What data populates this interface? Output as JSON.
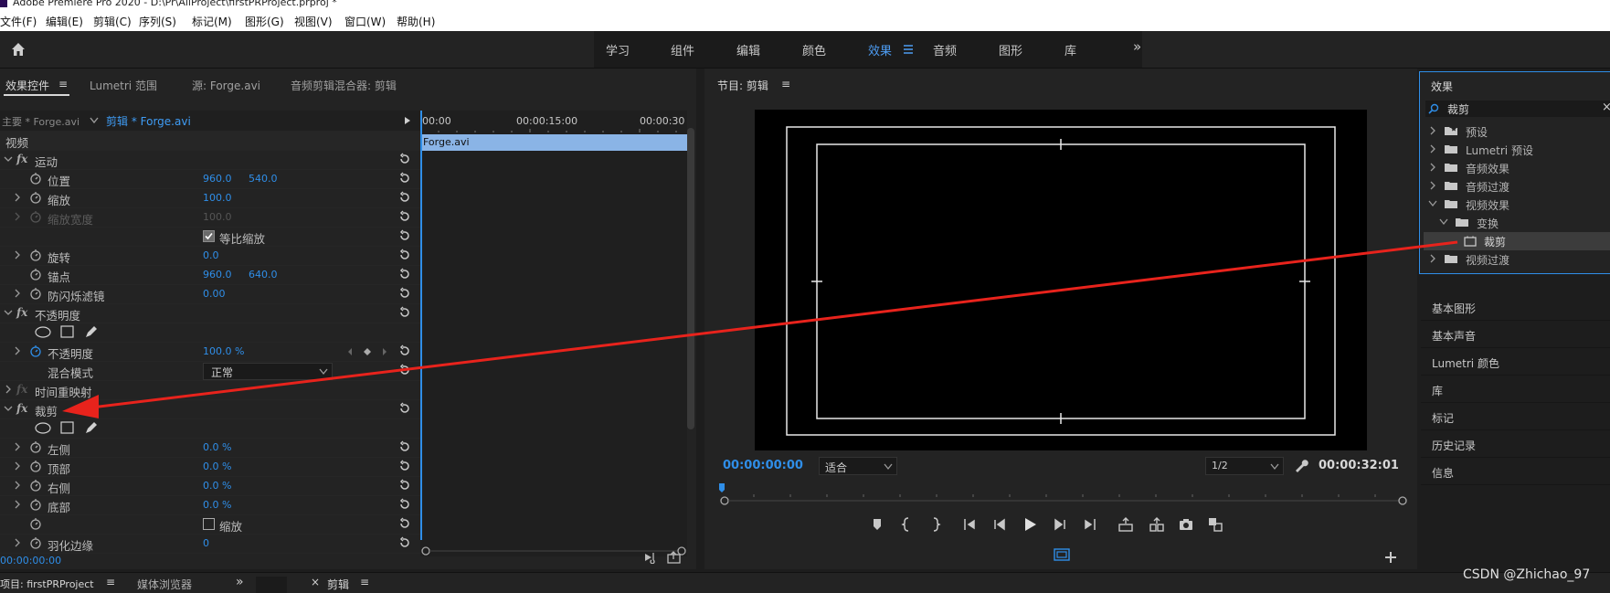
{
  "window": {
    "title": "Adobe Premiere Pro 2020 - D:\\Pr\\AllProject\\firstPRProject.prproj *"
  },
  "menu": [
    "文件(F)",
    "编辑(E)",
    "剪辑(C)",
    "序列(S)",
    "标记(M)",
    "图形(G)",
    "视图(V)",
    "窗口(W)",
    "帮助(H)"
  ],
  "workspaces": {
    "tabs": [
      "学习",
      "组件",
      "编辑",
      "颜色",
      "效果",
      "音频",
      "图形",
      "库"
    ],
    "active": "效果",
    "more": "»"
  },
  "effect_controls": {
    "tabs": [
      "效果控件",
      "Lumetri 范围",
      "源: Forge.avi",
      "音频剪辑混合器: 剪辑"
    ],
    "menu_glyph": "≡",
    "master_label": "主要 * Forge.avi",
    "clip_label": "剪辑 * Forge.avi",
    "section_video": "视频",
    "rows": {
      "motion": "运动",
      "position": "位置",
      "position_x": "960.0",
      "position_y": "540.0",
      "scale": "缩放",
      "scale_value": "100.0",
      "scale_width": "缩放宽度",
      "scale_width_value": "100.0",
      "uniform_scale": "等比缩放",
      "rotation": "旋转",
      "rotation_value": "0.0",
      "anchor": "锚点",
      "anchor_x": "960.0",
      "anchor_y": "640.0",
      "anti_flicker": "防闪烁滤镜",
      "anti_flicker_value": "0.00",
      "opacity_group": "不透明度",
      "opacity": "不透明度",
      "opacity_value": "100.0 %",
      "blend_mode": "混合模式",
      "blend_value": "正常",
      "time_remap": "时间重映射",
      "crop": "裁剪",
      "left": "左侧",
      "left_value": "0.0 %",
      "top": "顶部",
      "top_value": "0.0 %",
      "right": "右侧",
      "right_value": "0.0 %",
      "bottom": "底部",
      "bottom_value": "0.0 %",
      "zoom": "缩放",
      "feather": "羽化边缘",
      "feather_value": "0"
    },
    "timeline": {
      "t0": "00:00",
      "t1": "00:00:15:00",
      "t2": "00:00:30",
      "clip": "Forge.avi"
    },
    "timecode": "00:00:00:00"
  },
  "program": {
    "title": "节目: 剪辑",
    "menu_glyph": "≡",
    "timecode": "00:00:00:00",
    "fit": "适合",
    "resolution": "1/2",
    "duration": "00:00:32:01"
  },
  "effects_panel": {
    "title": "效果",
    "search_value": "裁剪",
    "tree": [
      "预设",
      "Lumetri 预设",
      "音频效果",
      "音频过渡",
      "视频效果",
      "变换",
      "裁剪",
      "视频过渡"
    ]
  },
  "right_panels": [
    "基本图形",
    "基本声音",
    "Lumetri 颜色",
    "库",
    "标记",
    "历史记录",
    "信息"
  ],
  "bottom": {
    "project_tab": "项目: firstPRProject",
    "media_browser": "媒体浏览器",
    "more": "»",
    "sequence_tab": "剪辑",
    "close": "×"
  },
  "watermark": "CSDN @Zhichao_97",
  "colors": {
    "accent": "#2f8ee8",
    "annotation_arrow": "#e8231c"
  }
}
